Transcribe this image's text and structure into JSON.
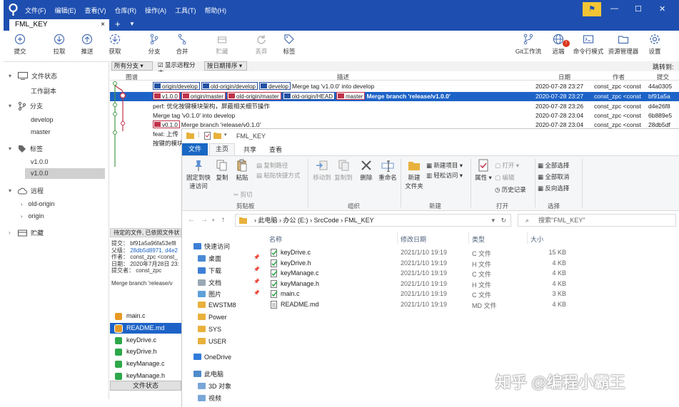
{
  "sourcetree": {
    "menu": [
      "文件(F)",
      "编辑(E)",
      "查看(V)",
      "仓库(R)",
      "操作(A)",
      "工具(T)",
      "帮助(H)"
    ],
    "window_controls": {
      "minimize": "—",
      "maximize": "☐",
      "close": "✕"
    },
    "tab": {
      "label": "FML_KEY",
      "close": "×",
      "add": "+",
      "dropdown": "▼"
    },
    "toolbar": {
      "commit": "提交",
      "pull": "拉取",
      "push": "推送",
      "fetch": "获取",
      "branch": "分支",
      "merge": "合并",
      "stash": "贮藏",
      "discard": "丢弃",
      "tag": "标签",
      "git_flow": "Git工作流",
      "remote": "远端",
      "terminal": "命令行模式",
      "explorer": "资源管理器",
      "settings": "设置",
      "remote_badge": "!"
    },
    "sidebar": {
      "workspace": {
        "label": "文件状态",
        "items": [
          "工作副本"
        ]
      },
      "branches": {
        "label": "分支",
        "items": [
          "develop",
          "master"
        ]
      },
      "tags": {
        "label": "标签",
        "items": [
          "v1.0.0",
          "v1.0.0"
        ]
      },
      "remotes": {
        "label": "远程",
        "items": [
          "old-origin",
          "origin"
        ]
      },
      "stashes": {
        "label": "贮藏"
      }
    },
    "filter": {
      "branches": "所有分支",
      "show_remote_label": "显示远程分支",
      "sort": "按日期排序",
      "jump_to": "跳转到:"
    },
    "log_columns": {
      "graph": "图谱",
      "description": "描述",
      "date": "日期",
      "author": "作者",
      "commit": "提交"
    },
    "log_rows": [
      {
        "tags": [
          {
            "t": "origin/develop",
            "c": "blue"
          },
          {
            "t": "old-origin/develop",
            "c": "blue"
          },
          {
            "t": "develop",
            "c": "blue"
          }
        ],
        "desc": "Merge tag 'v1.0.0' into develop",
        "date": "2020-07-28 23:27",
        "author": "const_zpc <const",
        "hash": "44a0305"
      },
      {
        "tags": [
          {
            "t": "v1.0.0",
            "c": "red"
          },
          {
            "t": "origin/master",
            "c": "red"
          },
          {
            "t": "old-origin/master",
            "c": "red"
          },
          {
            "t": "old-origin/HEAD",
            "c": "blue"
          },
          {
            "t": "master",
            "c": "red"
          }
        ],
        "desc": "Merge branch 'release/v1.0.0'",
        "date": "2020-07-28 23:27",
        "author": "const_zpc <const",
        "hash": "bf91a5a",
        "selected": true
      },
      {
        "tags": [],
        "desc": "perf: 优化按键模块架构，屏蔽相关细节操作",
        "date": "2020-07-28 23:26",
        "author": "const_zpc <const",
        "hash": "d4e26f8"
      },
      {
        "tags": [],
        "desc": "Merge tag 'v0.1.0' into develop",
        "date": "2020-07-28 23:04",
        "author": "const_zpc <const",
        "hash": "6b889e5"
      },
      {
        "tags": [
          {
            "t": "v0.1.0",
            "c": "red"
          }
        ],
        "desc": "Merge branch 'release/v0.1.0'",
        "date": "2020-07-28 23:04",
        "author": "const_zpc <const",
        "hash": "28db5df"
      },
      {
        "tags": [],
        "desc": "feat: 上传",
        "date": "",
        "author": "",
        "hash": ""
      },
      {
        "tags": [],
        "desc": "按键的模块",
        "date": "",
        "author": "",
        "hash": ""
      }
    ],
    "pending_bar": "待定的文件, 已依照文件状",
    "commit_info": {
      "commit_label": "提交：",
      "commit_value": "bf91a5a96fa53ef8",
      "parent_label": "父级：",
      "parent_value": "28db5d8971, d4e2",
      "author_label": "作者：",
      "author_value": "const_zpc <const_",
      "date_label": "日期：",
      "date_value": "2020年7月28日 23:",
      "committer_label": "提交者：",
      "committer_value": "const_zpc",
      "message": "Merge branch 'release/v"
    },
    "files": [
      {
        "name": "main.c",
        "state": "modified"
      },
      {
        "name": "README.md",
        "state": "modified",
        "selected": true
      },
      {
        "name": "keyDrive.c",
        "state": "added"
      },
      {
        "name": "keyDrive.h",
        "state": "added"
      },
      {
        "name": "keyManage.c",
        "state": "added"
      },
      {
        "name": "keyManage.h",
        "state": "added"
      }
    ],
    "file_status_button": "文件状态"
  },
  "explorer": {
    "title": "FML_KEY",
    "ribbon_tabs": {
      "file": "文件",
      "home": "主页",
      "share": "共享",
      "view": "查看"
    },
    "ribbon": {
      "pin_quick": "固定到快\n速访问",
      "copy": "复制",
      "paste": "粘贴",
      "copy_path": "复制路径",
      "paste_shortcut": "粘贴快捷方式",
      "cut": "剪切",
      "move_to": "移动到",
      "copy_to": "复制到",
      "delete": "删除",
      "rename": "重命名",
      "new_folder": "新建\n文件夹",
      "new_item": "新建项目",
      "easy_access": "轻松访问",
      "properties": "属性",
      "open": "打开",
      "edit": "编辑",
      "history": "历史记录",
      "select_all": "全部选择",
      "select_none": "全部取消",
      "invert": "反向选择",
      "group_clipboard": "剪贴板",
      "group_organize": "组织",
      "group_new": "新建",
      "group_open": "打开",
      "group_select": "选择"
    },
    "breadcrumb": [
      "此电脑",
      "办公 (E:)",
      "SrcCode",
      "FML_KEY"
    ],
    "search_placeholder": "搜索\"FML_KEY\"",
    "nav": {
      "quick_access": "快速访问",
      "items": [
        "桌面",
        "下载",
        "文档",
        "图片",
        "EWSTM8",
        "Power",
        "SYS",
        "USER"
      ],
      "onedrive": "OneDrive",
      "this_pc": "此电脑",
      "pc_items": [
        "3D 对象",
        "视频"
      ]
    },
    "columns": {
      "name": "名称",
      "modified": "修改日期",
      "type": "类型",
      "size": "大小"
    },
    "files": [
      {
        "name": "keyDrive.c",
        "date": "2021/1/10 19:19",
        "type": "C 文件",
        "size": "15 KB",
        "icon": "check"
      },
      {
        "name": "keyDrive.h",
        "date": "2021/1/10 19:19",
        "type": "H 文件",
        "size": "4 KB",
        "icon": "check"
      },
      {
        "name": "keyManage.c",
        "date": "2021/1/10 19:19",
        "type": "C 文件",
        "size": "4 KB",
        "icon": "check"
      },
      {
        "name": "keyManage.h",
        "date": "2021/1/10 19:19",
        "type": "H 文件",
        "size": "4 KB",
        "icon": "check"
      },
      {
        "name": "main.c",
        "date": "2021/1/10 19:19",
        "type": "C 文件",
        "size": "3 KB",
        "icon": "check"
      },
      {
        "name": "README.md",
        "date": "2021/1/10 19:19",
        "type": "MD 文件",
        "size": "4 KB",
        "icon": "doc"
      }
    ]
  },
  "watermark": "知乎 @编程小霸王",
  "colors": {
    "title_blue": "#1e4fb0",
    "selection_blue": "#1d63c7",
    "explorer_file_tab": "#1968c4",
    "tag_red": "#c0324a",
    "tag_blue": "#2451a3",
    "added_green": "#2ea84a",
    "modified_orange": "#e69a24"
  }
}
